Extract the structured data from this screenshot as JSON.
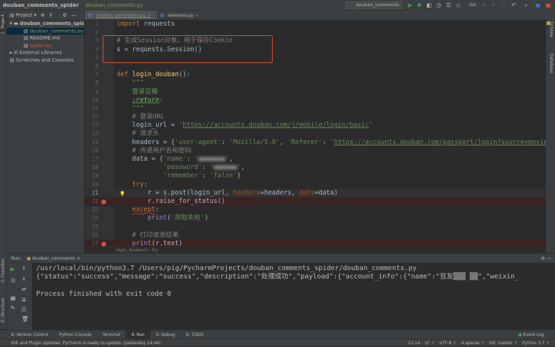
{
  "titlebar": {
    "project": "douban_comments_spider",
    "file": "douban_comments.py",
    "run_config": "douban_comments",
    "git_label": "Git:"
  },
  "project_panel": {
    "header": "Project",
    "items": [
      {
        "label": "douban_comments_spide",
        "type": "folder",
        "depth": 0,
        "color": "#bbbbbb"
      },
      {
        "label": "douban_comments.py",
        "type": "py",
        "depth": 1,
        "color": "#8a9a5b",
        "selected": true
      },
      {
        "label": "README.md",
        "type": "md",
        "depth": 1,
        "color": "#bbbbbb"
      },
      {
        "label": "spider.py",
        "type": "py",
        "depth": 1,
        "color": "#c75450"
      },
      {
        "label": "External Libraries",
        "type": "lib",
        "depth": 0,
        "color": "#bbbbbb"
      },
      {
        "label": "Scratches and Consoles",
        "type": "scratch",
        "depth": 0,
        "color": "#bbbbbb"
      }
    ]
  },
  "side_labels": {
    "project": "1: Project",
    "favorites": "2: Favorites",
    "structure": "Z: Structure",
    "sciview": "SciView",
    "database": "Database"
  },
  "tabs": [
    {
      "label": "douban_comments.py",
      "active": true
    },
    {
      "label": "sessions.py",
      "active": false
    }
  ],
  "code_lines": [
    [
      [
        "import",
        "kw"
      ],
      [
        " requests",
        ""
      ]
    ],
    [],
    [
      [
        "# 生成Session对象，用于保存Cookie",
        "cm"
      ]
    ],
    [
      [
        "s = requests.Session()",
        ""
      ]
    ],
    [],
    [],
    [
      [
        "def",
        "kw"
      ],
      [
        " ",
        ""
      ],
      [
        "login_douban",
        "fn"
      ],
      [
        "():",
        ""
      ]
    ],
    [
      [
        "    \"\"\"",
        "doc"
      ]
    ],
    [
      [
        "    登录豆瓣",
        "doc"
      ]
    ],
    [
      [
        "    ",
        ""
      ],
      [
        ":return",
        "doctag"
      ],
      [
        ":",
        "doc"
      ]
    ],
    [
      [
        "    \"\"\"",
        "doc"
      ]
    ],
    [
      [
        "    # 登录URL",
        "cm"
      ]
    ],
    [
      [
        "    login_url = ",
        ""
      ],
      [
        "'",
        "str"
      ],
      [
        "https://accounts.douban.com/j/mobile/login/basic",
        "url"
      ],
      [
        "'",
        "str"
      ]
    ],
    [
      [
        "    # 请求头",
        "cm"
      ]
    ],
    [
      [
        "    headers = {",
        ""
      ],
      [
        "'user-agent'",
        "str"
      ],
      [
        ": ",
        ""
      ],
      [
        "'Mozilla/5.0'",
        "str"
      ],
      [
        ", ",
        ""
      ],
      [
        "'Referer'",
        "str"
      ],
      [
        ": ",
        ""
      ],
      [
        "'",
        "str"
      ],
      [
        "https://accounts.douban.com/passport/login?source=movie",
        "url"
      ]
    ],
    [
      [
        "    # 传递用户名和密码",
        "cm"
      ]
    ],
    [
      [
        "    data = {",
        ""
      ],
      [
        "'name'",
        "str"
      ],
      [
        ": ",
        ""
      ],
      [
        "'",
        "str"
      ],
      [
        "■■■■■■■",
        "blur"
      ],
      [
        "'",
        "str"
      ],
      [
        ",",
        ""
      ]
    ],
    [
      [
        "            ",
        ""
      ],
      [
        "'password'",
        "str"
      ],
      [
        ": ",
        ""
      ],
      [
        "'",
        "str"
      ],
      [
        "■■■■■■",
        "blur"
      ],
      [
        "'",
        "str"
      ],
      [
        ",",
        ""
      ]
    ],
    [
      [
        "            ",
        ""
      ],
      [
        "'remember'",
        "str"
      ],
      [
        ": ",
        ""
      ],
      [
        "'false'",
        "str"
      ],
      [
        "}",
        ""
      ]
    ],
    [
      [
        "    ",
        ""
      ],
      [
        "try",
        "kw"
      ],
      [
        ":",
        ""
      ]
    ],
    [
      [
        "        r = ",
        ""
      ],
      [
        "s",
        "squig"
      ],
      [
        ".post(login_url, ",
        ""
      ],
      [
        "headers",
        "par"
      ],
      [
        "=headers, ",
        ""
      ],
      [
        "data",
        "par"
      ],
      [
        "=data)",
        ""
      ]
    ],
    [
      [
        "        r.raise_for_status()",
        ""
      ]
    ],
    [
      [
        "    ",
        ""
      ],
      [
        "except",
        "kw squig"
      ],
      [
        ":",
        ""
      ]
    ],
    [
      [
        "        ",
        ""
      ],
      [
        "print",
        "bi"
      ],
      [
        "(",
        ""
      ],
      [
        "'爬取失败'",
        "str"
      ],
      [
        ")",
        ""
      ]
    ],
    [],
    [
      [
        "    # 打印请求结果",
        "cm"
      ]
    ],
    [
      [
        "    ",
        ""
      ],
      [
        "print",
        "bi"
      ],
      [
        "(r.text)",
        ""
      ]
    ]
  ],
  "current_line": 21,
  "breakpoint_lines": [
    22,
    27
  ],
  "bulb_line": 21,
  "breadcrumb": "login_douban()  ›  try",
  "run_panel": {
    "label": "Run:",
    "tab": "douban_comments",
    "output": [
      "/usr/local/bin/python3.7 /Users/pig/PycharmProjects/douban_comments_spider/douban_comments.py",
      "{\"status\":\"success\",\"message\":\"success\",\"description\":\"处理成功\",\"payload\":{\"account_info\":{\"name\":\"豆友▒▒▒ ▒▒\",\"weixin_",
      "",
      "Process finished with exit code 0"
    ]
  },
  "tool_tabs": [
    {
      "label": "9: Version Control"
    },
    {
      "label": "Python Console"
    },
    {
      "label": "Terminal"
    },
    {
      "label": "4: Run",
      "active": true
    },
    {
      "label": "5: Debug"
    },
    {
      "label": "6: TODO"
    }
  ],
  "event_log": "Event Log",
  "status": {
    "message": "IDE and Plugin Updates: PyCharm is ready to update. (yesterday 14:44)",
    "right": [
      "21:14",
      "LF ÷",
      "UTF-8 ÷",
      "4 spaces ÷",
      "Git: master ÷",
      "Python 3.7 ÷"
    ]
  },
  "colors": {
    "highlight_box": "#e0552e",
    "run_green": "#499c54",
    "breakpoint": "#c75450"
  }
}
